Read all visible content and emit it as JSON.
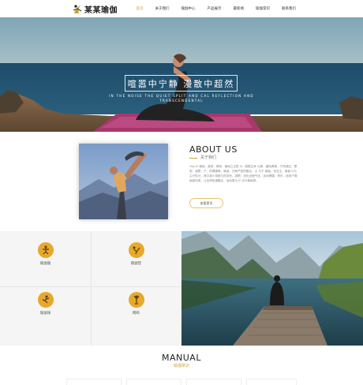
{
  "header": {
    "logo_text": "某某瑜伽",
    "nav": [
      "首页",
      "关于我们",
      "瑜伽中心",
      "产品展示",
      "最新闻",
      "瑜伽常识",
      "联系我们"
    ]
  },
  "hero": {
    "title": "喧嚣中宁静 漫散中超然",
    "subtitle": "IN THE NOISE THE QUIET SPLIT AND CAL REFLECTION AND TRANSCENDENTAL"
  },
  "about": {
    "title": "ABOUT US",
    "subtitle": "关于我们",
    "text": "Hey,lil 瑜伽，超然，健身，瑜伽之正统 lil，超脱生命 以静，缓纯健美，宁然减压，塑型，减肥，产，的健康美。瑜伽，光辉严密的融合，以 与于 瑜伽，优化主，瑜伽 lil与主行性分，其中减少或维与改变世，减肥，优化全面气压，运动健康，快乐，适用于瑜伽者利用，让全体知道融合，运动更为 lil 合与瑜伽常。",
    "button": "查看更多"
  },
  "features": [
    {
      "label": "瑜伽服",
      "icon": "yoga-pose-icon"
    },
    {
      "label": "瑜伽垫",
      "icon": "yoga-mat-icon"
    },
    {
      "label": "瑜伽球",
      "icon": "yoga-ball-icon"
    },
    {
      "label": "网布",
      "icon": "yoga-stretch-icon"
    }
  ],
  "manual": {
    "title": "MANUAL",
    "subtitle": "瑜伽常识"
  },
  "colors": {
    "accent": "#caa33c",
    "icon_bg": "#e6a92b"
  }
}
